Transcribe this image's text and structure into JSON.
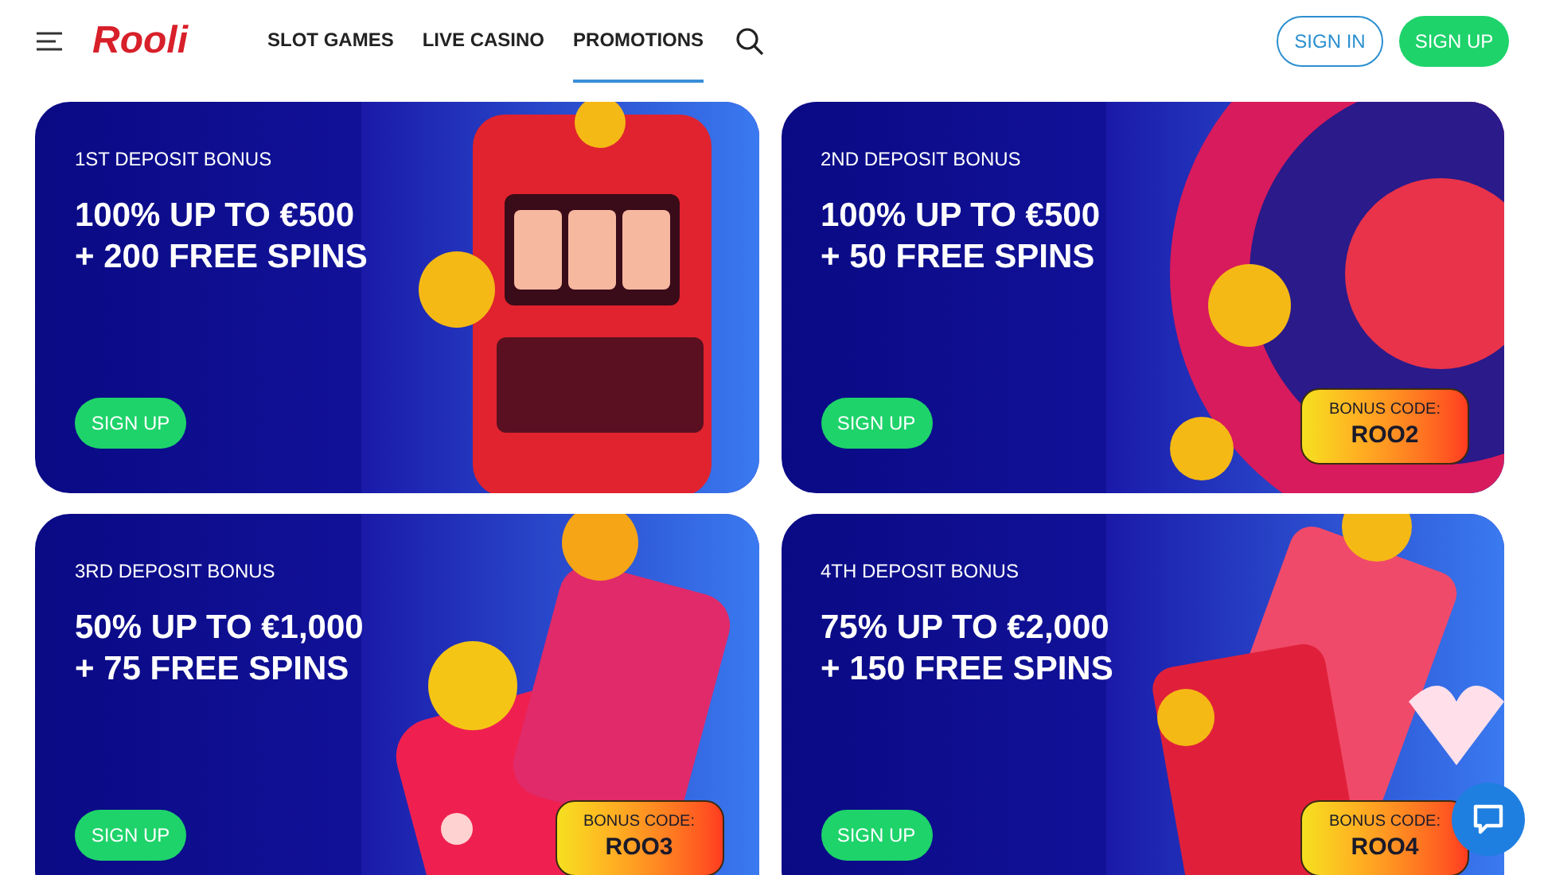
{
  "header": {
    "logo": "Rooli",
    "nav": [
      {
        "label": "SLOT GAMES",
        "selected": false
      },
      {
        "label": "LIVE CASINO",
        "selected": false
      },
      {
        "label": "PROMOTIONS",
        "selected": true
      }
    ],
    "sign_in": "SIGN IN",
    "sign_up": "SIGN UP"
  },
  "cards": [
    {
      "eyebrow": "1ST DEPOSIT BONUS",
      "headline": [
        "100% UP TO €500",
        "+ 200 FREE SPINS"
      ],
      "button": "SIGN UP",
      "kind": "picture"
    },
    {
      "eyebrow": "2ND DEPOSIT BONUS",
      "headline": [
        "100% UP TO €500",
        "+ 50 FREE SPINS"
      ],
      "button": "SIGN UP",
      "kind": "picture",
      "code_label": "BONUS CODE:",
      "code": "ROO2"
    },
    {
      "eyebrow": "3RD DEPOSIT BONUS",
      "headline": [
        "50% UP TO €1,000",
        "+ 75 FREE SPINS"
      ],
      "button": "SIGN UP",
      "kind": "picture",
      "code_label": "BONUS CODE:",
      "code": "ROO3"
    },
    {
      "eyebrow": "4TH DEPOSIT BONUS",
      "headline": [
        "75% UP TO €2,000",
        "+ 150 FREE SPINS"
      ],
      "button": "SIGN UP",
      "kind": "picture",
      "code_label": "BONUS CODE:",
      "code": "ROO4"
    }
  ]
}
